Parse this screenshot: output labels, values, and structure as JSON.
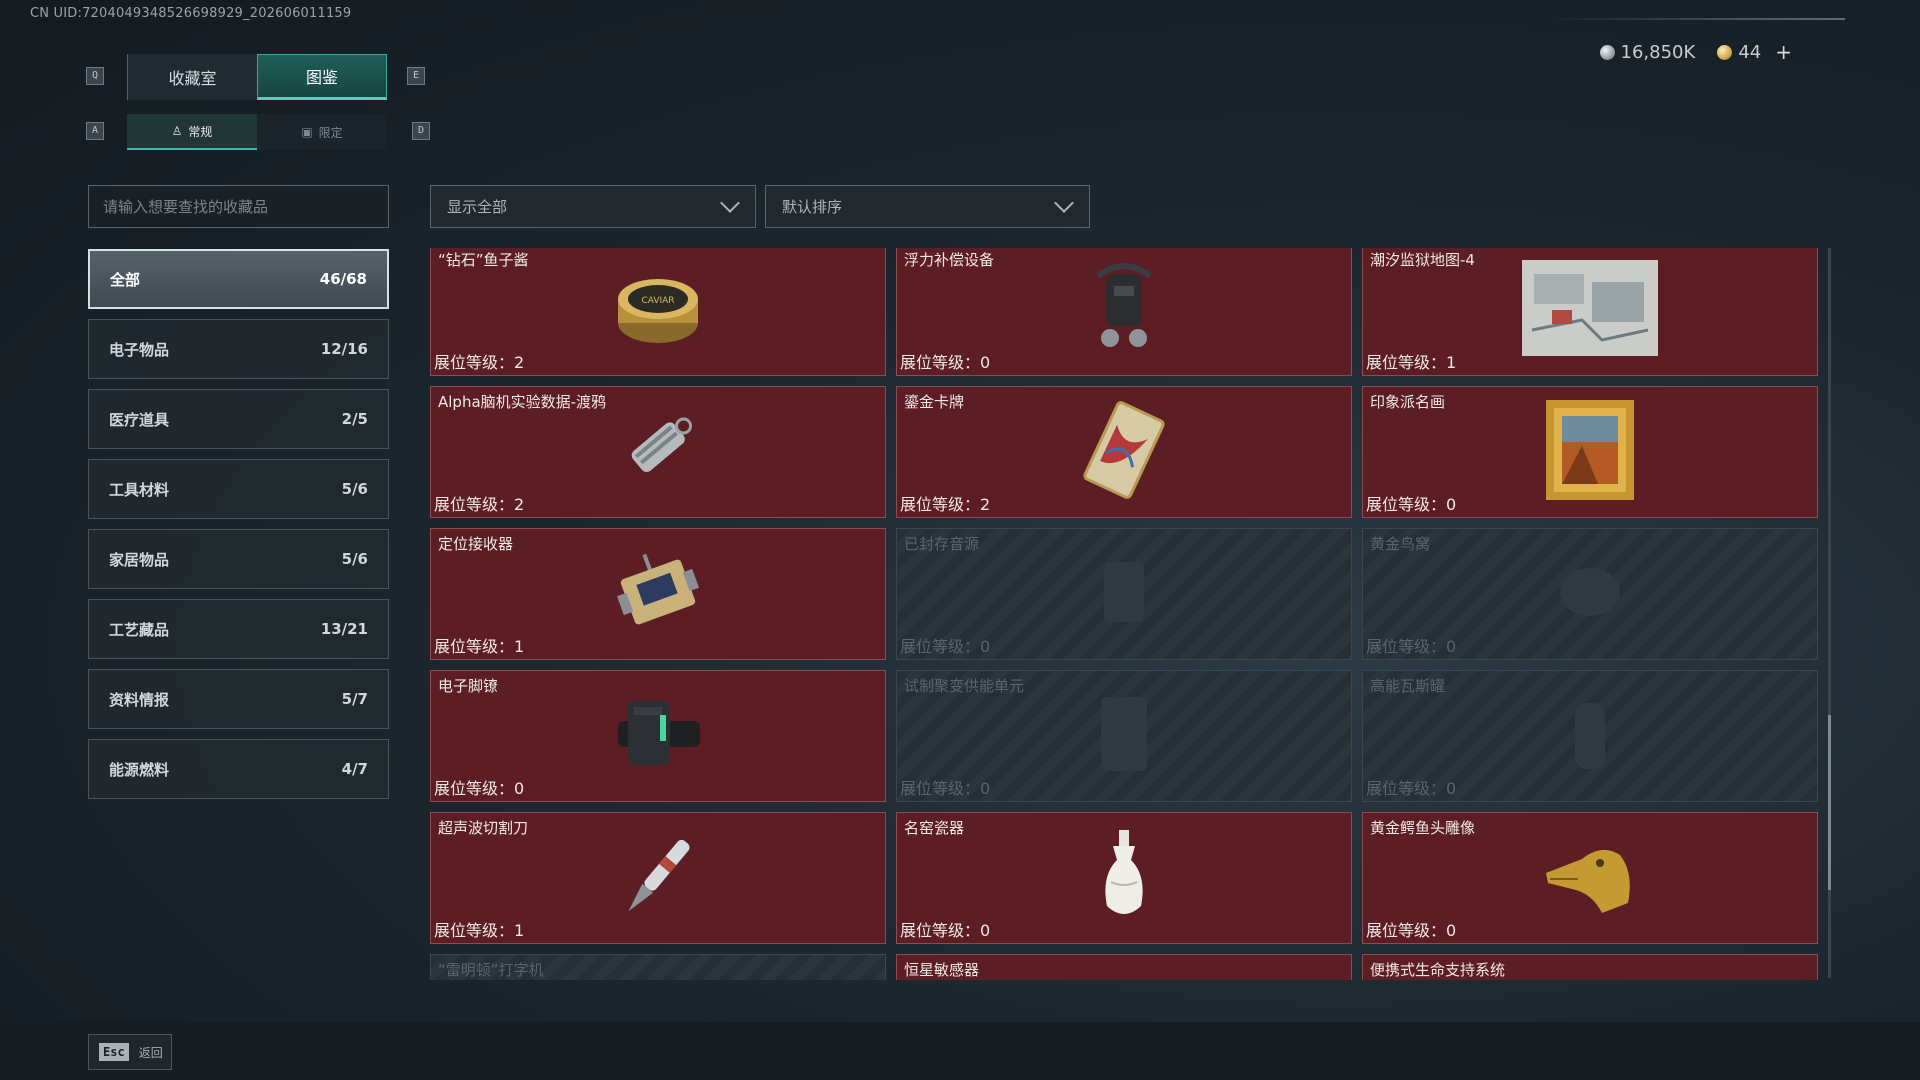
{
  "uid_text": "CN UID:7204049348526698929_202606011159",
  "currency": {
    "silver": "16,850K",
    "gold": "44",
    "add_icon": "plus-icon"
  },
  "keys": {
    "prev_tab": "Q",
    "next_tab": "E",
    "prev_subtab": "A",
    "next_subtab": "D"
  },
  "tabs": [
    "收藏室",
    "图鉴"
  ],
  "subtabs": [
    "常规",
    "限定"
  ],
  "search": {
    "placeholder": "请输入想要查找的收藏品"
  },
  "filters": {
    "show": "显示全部",
    "sort": "默认排序"
  },
  "categories": [
    {
      "label": "全部",
      "count": "46/68"
    },
    {
      "label": "电子物品",
      "count": "12/16"
    },
    {
      "label": "医疗道具",
      "count": "2/5"
    },
    {
      "label": "工具材料",
      "count": "5/6"
    },
    {
      "label": "家居物品",
      "count": "5/6"
    },
    {
      "label": "工艺藏品",
      "count": "13/21"
    },
    {
      "label": "资料情报",
      "count": "5/7"
    },
    {
      "label": "能源燃料",
      "count": "4/7"
    }
  ],
  "items": [
    {
      "name": "“钻石”鱼子酱",
      "level": "展位等级：2",
      "icon": "caviar-tin-icon"
    },
    {
      "name": "浮力补偿设备",
      "level": "展位等级：0",
      "icon": "buoyancy-device-icon"
    },
    {
      "name": "潮汐监狱地图-4",
      "level": "展位等级：1",
      "icon": "map-icon"
    },
    {
      "name": "Alpha脑机实验数据-渡鸦",
      "level": "展位等级：2",
      "icon": "data-drive-icon"
    },
    {
      "name": "鎏金卡牌",
      "level": "展位等级：2",
      "icon": "gilded-card-icon"
    },
    {
      "name": "印象派名画",
      "level": "展位等级：0",
      "icon": "painting-icon"
    },
    {
      "name": "定位接收器",
      "level": "展位等级：1",
      "icon": "receiver-icon"
    },
    {
      "name": "已封存音源",
      "level": "展位等级：0",
      "icon": "locked-item-icon"
    },
    {
      "name": "黄金鸟窝",
      "level": "展位等级：0",
      "icon": "locked-item-icon"
    },
    {
      "name": "电子脚镣",
      "level": "展位等级：0",
      "icon": "ankle-monitor-icon"
    },
    {
      "name": "试制聚变供能单元",
      "level": "展位等级：0",
      "icon": "locked-item-icon"
    },
    {
      "name": "高能瓦斯罐",
      "level": "展位等级：0",
      "icon": "locked-item-icon"
    },
    {
      "name": "超声波切割刀",
      "level": "展位等级：1",
      "icon": "cutter-icon"
    },
    {
      "name": "名窑瓷器",
      "level": "展位等级：0",
      "icon": "porcelain-vase-icon"
    },
    {
      "name": "黄金鳄鱼头雕像",
      "level": "展位等级：0",
      "icon": "crocodile-statue-icon"
    },
    {
      "name": "“雷明顿”打字机",
      "level": "",
      "icon": "locked-item-icon"
    },
    {
      "name": "恒星敏感器",
      "level": "",
      "icon": "star-sensor-icon"
    },
    {
      "name": "便携式生命支持系统",
      "level": "",
      "icon": "life-support-icon"
    }
  ],
  "footer": {
    "esc_key": "Esc",
    "esc_label": "返回"
  }
}
